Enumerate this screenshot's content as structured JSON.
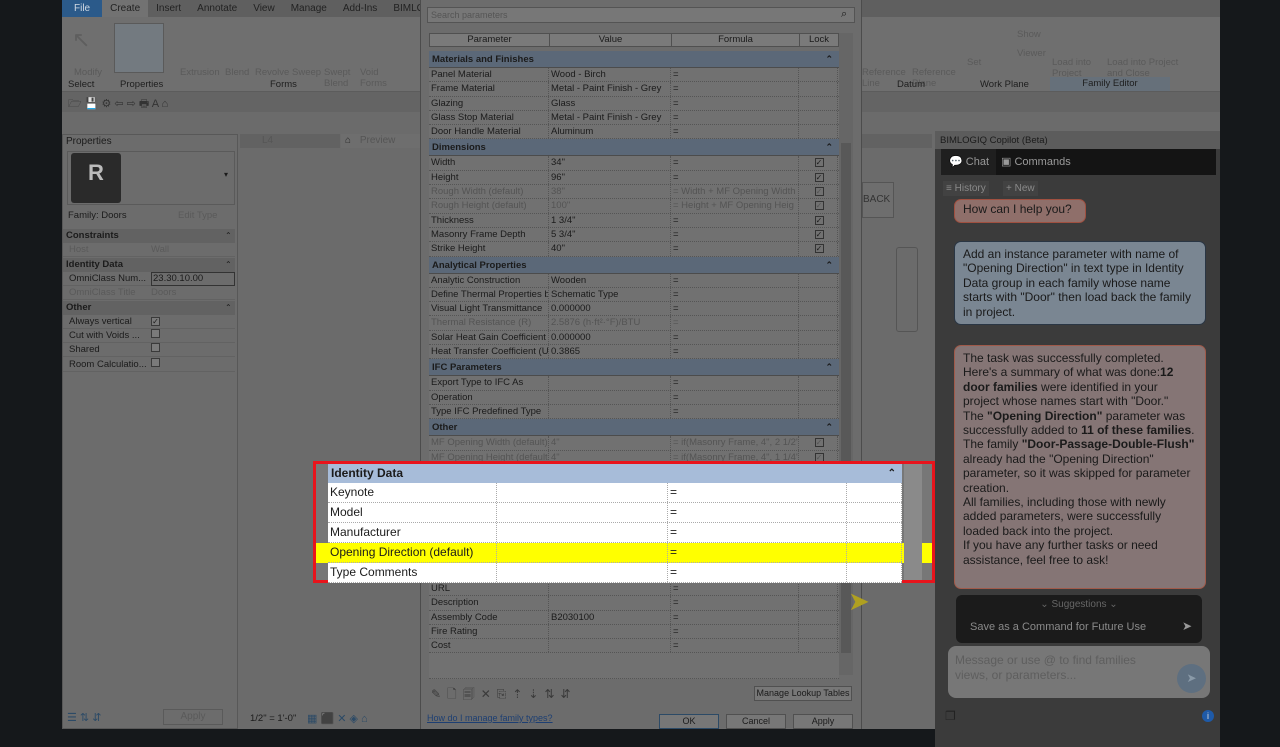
{
  "ribbon": {
    "tabs": [
      "File",
      "Create",
      "Insert",
      "Annotate",
      "View",
      "Manage",
      "Add-Ins",
      "BIMLOGIQ"
    ],
    "buttons": [
      "Modify",
      "Extrusion",
      "Blend",
      "Revolve",
      "Sweep",
      "Swept Blend",
      "Void Forms",
      "Reference Line",
      "Reference Plane",
      "Set",
      "Show",
      "Viewer",
      "Load into Project",
      "Load into Project and Close"
    ],
    "groups": [
      "Select",
      "Properties",
      "Forms",
      "Datum",
      "Work Plane",
      "Family Editor"
    ]
  },
  "properties": {
    "title": "Properties",
    "logo": "R",
    "family": "Family: Doors",
    "edit_type": "Edit Type",
    "apply": "Apply",
    "groups": [
      {
        "name": "Constraints",
        "rows": [
          {
            "k": "Host",
            "v": "Wall",
            "dim": true
          }
        ]
      },
      {
        "name": "Identity Data",
        "rows": [
          {
            "k": "OmniClass Num...",
            "v": "23.30.10.00"
          },
          {
            "k": "OmniClass Title",
            "v": "Doors",
            "dim": true
          }
        ]
      },
      {
        "name": "Other",
        "rows": [
          {
            "k": "Always vertical",
            "check": true
          },
          {
            "k": "Cut with Voids ...",
            "check": false
          },
          {
            "k": "Shared",
            "check": false
          },
          {
            "k": "Room Calculatio...",
            "check": false
          }
        ]
      }
    ]
  },
  "view": {
    "tab_l4": "L4",
    "tab_preview": "Preview",
    "back": "BACK",
    "scale": "1/2\" = 1'-0\""
  },
  "dialog": {
    "search_placeholder": "Search parameters",
    "headers": [
      "Parameter",
      "Value",
      "Formula",
      "Lock"
    ],
    "groups": [
      {
        "name": "Materials and Finishes",
        "rows": [
          [
            "Panel Material",
            "Wood - Birch",
            "=",
            ""
          ],
          [
            "Frame Material",
            "Metal - Paint Finish - Grey",
            "=",
            ""
          ],
          [
            "Glazing",
            "Glass",
            "=",
            ""
          ],
          [
            "Glass Stop Material",
            "Metal - Paint Finish - Grey",
            "=",
            ""
          ],
          [
            "Door Handle Material",
            "Aluminum",
            "=",
            ""
          ]
        ]
      },
      {
        "name": "Dimensions",
        "rows": [
          [
            "Width",
            "34\"",
            "=",
            "x"
          ],
          [
            "Height",
            "96\"",
            "=",
            "x"
          ],
          [
            "Rough Width (default)",
            "38\"",
            "= Width + MF Opening Width",
            "x",
            "d"
          ],
          [
            "Rough Height (default)",
            "100\"",
            "= Height + MF Opening Heig",
            "x",
            "d"
          ],
          [
            "Thickness",
            "1 3/4\"",
            "=",
            "x"
          ],
          [
            "Masonry Frame Depth",
            "5 3/4\"",
            "=",
            "x"
          ],
          [
            "Strike Height",
            "40\"",
            "=",
            "x"
          ]
        ]
      },
      {
        "name": "Analytical Properties",
        "rows": [
          [
            "Analytic Construction",
            "Wooden",
            "=",
            ""
          ],
          [
            "Define Thermal Properties b",
            "Schematic Type",
            "=",
            ""
          ],
          [
            "Visual Light Transmittance",
            "0.000000",
            "=",
            ""
          ],
          [
            "Thermal Resistance (R)",
            "2.5876 (h·ft²·°F)/BTU",
            "=",
            "",
            "d"
          ],
          [
            "Solar Heat Gain Coefficient",
            "0.000000",
            "=",
            ""
          ],
          [
            "Heat Transfer Coefficient (U",
            "0.3865",
            "=",
            ""
          ]
        ]
      },
      {
        "name": "IFC Parameters",
        "rows": [
          [
            "Export Type to IFC As",
            "",
            "=",
            ""
          ],
          [
            "Operation",
            "",
            "=",
            ""
          ],
          [
            "Type IFC Predefined Type",
            "",
            "=",
            ""
          ]
        ]
      },
      {
        "name": "Other",
        "rows": [
          [
            "MF Opening Width (default)",
            "4\"",
            "= if(Masonry Frame, 4\", 2 1/2\"",
            "x",
            "d"
          ],
          [
            "MF Opening Height (default)",
            "4\"",
            "= if(Masonry Frame, 4\", 1 1/4\"",
            "x",
            "d"
          ]
        ]
      }
    ],
    "lower_rows": [
      [
        "URL",
        "",
        "="
      ],
      [
        "Description",
        "",
        "="
      ],
      [
        "Assembly Code",
        "B2030100",
        "="
      ],
      [
        "Fire Rating",
        "",
        "="
      ],
      [
        "Cost",
        "",
        "="
      ]
    ],
    "highlight": {
      "group": "Identity Data",
      "rows": [
        [
          "Keynote",
          "",
          "="
        ],
        [
          "Model",
          "",
          "="
        ],
        [
          "Manufacturer",
          "",
          "="
        ],
        [
          "Opening Direction (default)",
          "",
          "="
        ],
        [
          "Type Comments",
          "",
          "="
        ]
      ],
      "highlighted_index": 3
    },
    "manage_lookup": "Manage Lookup Tables",
    "help_link": "How do I manage family types?",
    "ok": "OK",
    "cancel": "Cancel",
    "apply": "Apply"
  },
  "copilot": {
    "title": "BIMLOGIQ Copilot (Beta)",
    "tab_chat": "Chat",
    "tab_commands": "Commands",
    "history": "History",
    "new": "New",
    "greeting": "How can I help you?",
    "user_msg": "Add an instance parameter with name of \"Opening Direction\" in text type in Identity Data group in each family whose name starts with \"Door\" then load back the family in project.",
    "reply": [
      [
        "The task was successfully completed. Here's a summary of what was done:",
        ""
      ],
      [
        "12 door families",
        "b"
      ],
      [
        " were identified in your project whose names start with \"Door.\"",
        ""
      ],
      [
        "The ",
        ""
      ],
      [
        "\"Opening Direction\"",
        "b"
      ],
      [
        " parameter was successfully added to ",
        ""
      ],
      [
        "11 of these families",
        "b"
      ],
      [
        ".",
        ""
      ],
      [
        "The family ",
        ""
      ],
      [
        "\"Door-Passage-Double-Flush\"",
        "b"
      ],
      [
        " already had the \"Opening Direction\" parameter, so it was skipped for parameter creation.",
        ""
      ],
      [
        "All families, including those with newly added parameters, were successfully loaded back into the project.",
        ""
      ],
      [
        "If you have any further tasks or need assistance, feel free to ask!",
        ""
      ]
    ],
    "suggestions": "Suggestions",
    "suggestion": "Save as a Command for Future Use",
    "input_placeholder": "Message or use @ to find families views, or parameters..."
  },
  "colors": {
    "highlight": "#ffff00",
    "border": "#e8141c",
    "file_tab": "#2b5a8a"
  }
}
